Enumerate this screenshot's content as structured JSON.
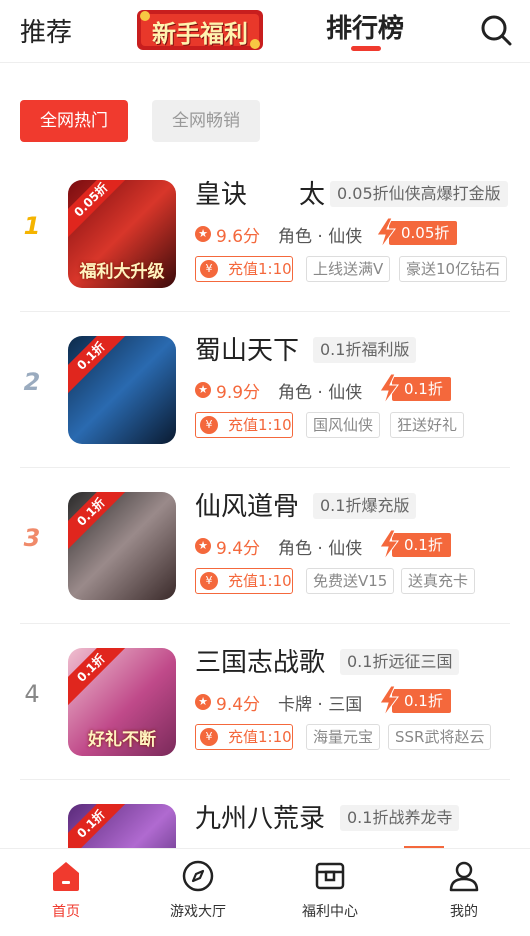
{
  "header": {
    "tab_recommend": "推荐",
    "banner_text": "新手福利",
    "tab_ranking": "排行榜",
    "accent_color": "#f03a2e"
  },
  "filters": {
    "active": "全网热门",
    "inactive": "全网畅销"
  },
  "games": [
    {
      "rank": "1",
      "title": "皇诀　　太",
      "subtitle": "0.05折仙侠高爆打金版",
      "score": "9.6分",
      "genre": "角色 · 仙侠",
      "discount": "0.05折",
      "cover_corner": "0.05折",
      "cover_art": "福利大升级",
      "charge": "充值1:10",
      "tags": [
        "上线送满V",
        "豪送10亿钻石"
      ]
    },
    {
      "rank": "2",
      "title": "蜀山天下",
      "subtitle": "0.1折福利版",
      "score": "9.9分",
      "genre": "角色 · 仙侠",
      "discount": "0.1折",
      "cover_corner": "0.1折",
      "cover_art": "",
      "charge": "充值1:10",
      "tags": [
        "国风仙侠",
        "狂送好礼"
      ]
    },
    {
      "rank": "3",
      "title": "仙风道骨",
      "subtitle": "0.1折爆充版",
      "score": "9.4分",
      "genre": "角色 · 仙侠",
      "discount": "0.1折",
      "cover_corner": "0.1折",
      "cover_art": "",
      "charge": "充值1:10",
      "tags": [
        "免费送V15",
        "送真充卡"
      ]
    },
    {
      "rank": "4",
      "title": "三国志战歌",
      "subtitle": "0.1折远征三国",
      "score": "9.4分",
      "genre": "卡牌 · 三国",
      "discount": "0.1折",
      "cover_corner": "0.1折",
      "cover_art": "好礼不断",
      "charge": "充值1:10",
      "tags": [
        "海量元宝",
        "SSR武将赵云"
      ]
    },
    {
      "rank": "",
      "title": "九州八荒录",
      "subtitle": "0.1折战养龙寺",
      "score": "",
      "genre": "",
      "discount": "",
      "cover_corner": "0.1折",
      "cover_art": "",
      "charge": "",
      "tags": []
    }
  ],
  "bottom_nav": [
    {
      "label": "首页",
      "icon": "home-icon",
      "active": true
    },
    {
      "label": "游戏大厅",
      "icon": "compass-icon",
      "active": false
    },
    {
      "label": "福利中心",
      "icon": "gift-box-icon",
      "active": false
    },
    {
      "label": "我的",
      "icon": "user-icon",
      "active": false
    }
  ]
}
